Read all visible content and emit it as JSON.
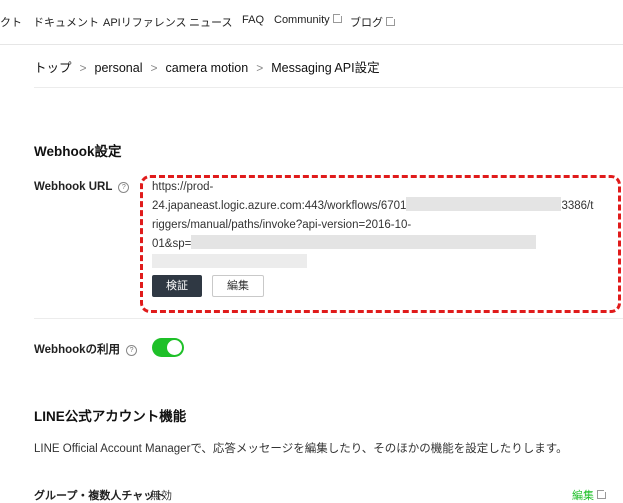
{
  "nav": {
    "items": [
      {
        "label": "クト",
        "external": false
      },
      {
        "label": "ドキュメント",
        "external": false
      },
      {
        "label": "APIリファレンス",
        "external": false
      },
      {
        "label": "ニュース",
        "external": false
      },
      {
        "label": "FAQ",
        "external": false
      },
      {
        "label": "Community",
        "external": true
      },
      {
        "label": "ブログ",
        "external": true
      }
    ]
  },
  "breadcrumb": [
    "トップ",
    "personal",
    "camera motion",
    "Messaging API設定"
  ],
  "breadcrumb_separator": ">",
  "webhook_section": {
    "title": "Webhook設定",
    "url_label": "Webhook URL",
    "url_lines": [
      "https://prod-",
      "24.japaneast.logic.azure.com:443/workflows/6701",
      "3386/t",
      "riggers/manual/paths/invoke?api-version=2016-10-",
      "01&sp="
    ],
    "verify_button": "検証",
    "edit_button": "編集",
    "use_label": "Webhookの利用",
    "use_enabled": true
  },
  "account_section": {
    "title": "LINE公式アカウント機能",
    "description": "LINE Official Account Managerで、応答メッセージを編集したり、そのほかの機能を設定したりします。",
    "partial_row_label": "グループ・複数人チャット",
    "partial_row_value": "無効",
    "partial_row_action": "編集"
  },
  "colors": {
    "accent_green": "#1ec028",
    "annotation_red": "#e01b1b",
    "button_dark": "#2f3843"
  }
}
